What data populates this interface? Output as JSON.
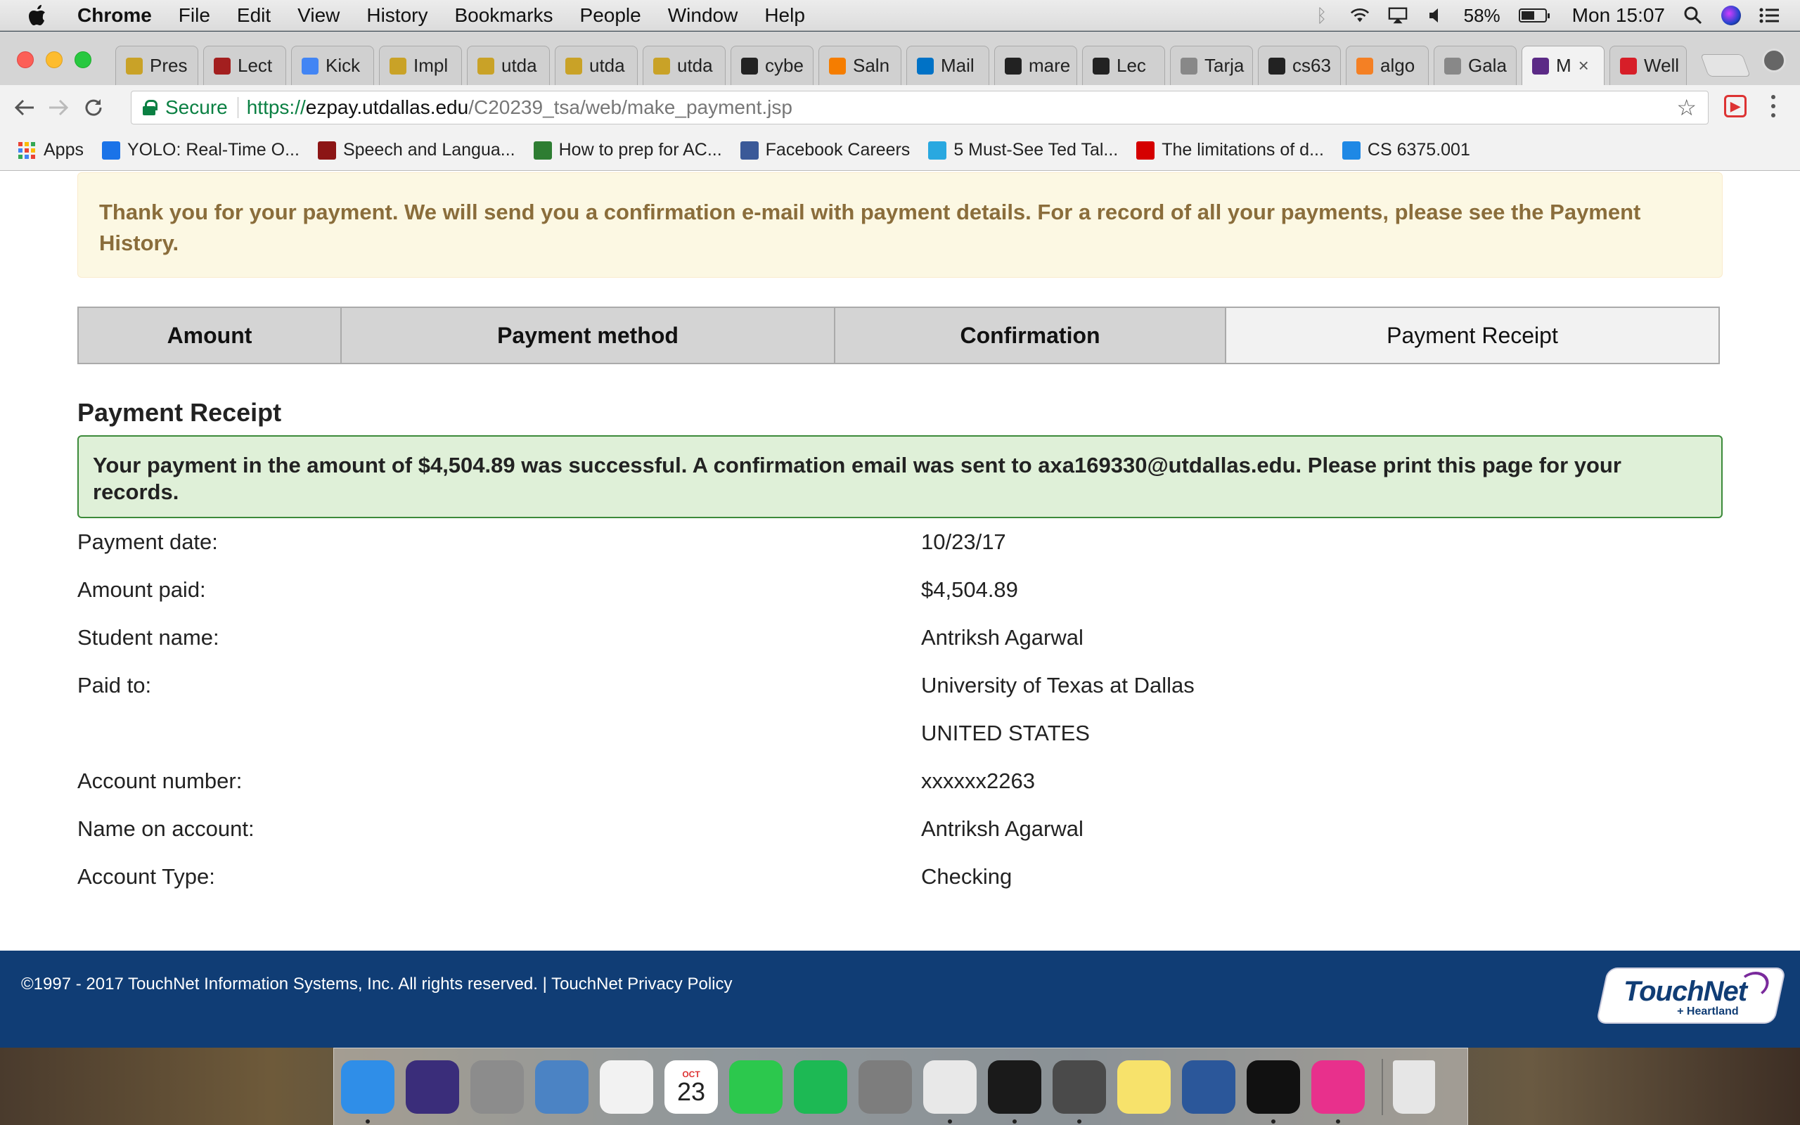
{
  "menubar": {
    "app_name": "Chrome",
    "items": [
      "File",
      "Edit",
      "View",
      "History",
      "Bookmarks",
      "People",
      "Window",
      "Help"
    ],
    "battery": "58%",
    "battery_level": 0.58,
    "clock": "Mon 15:07"
  },
  "tabs": [
    {
      "title": "Pres",
      "icon": "utd-logo",
      "color": "#c9a227"
    },
    {
      "title": "Lect",
      "icon": "c-logo",
      "color": "#a31f1f"
    },
    {
      "title": "Kick",
      "icon": "google-logo",
      "color": "#4285f4"
    },
    {
      "title": "Impl",
      "icon": "utd-logo",
      "color": "#c9a227"
    },
    {
      "title": "utda",
      "icon": "utd-logo",
      "color": "#c9a227"
    },
    {
      "title": "utda",
      "icon": "utd-logo",
      "color": "#c9a227"
    },
    {
      "title": "utda",
      "icon": "utd-logo",
      "color": "#c9a227"
    },
    {
      "title": "cybe",
      "icon": "github-logo",
      "color": "#222222"
    },
    {
      "title": "Saln",
      "icon": "blogger-logo",
      "color": "#f57d00"
    },
    {
      "title": "Mail",
      "icon": "outlook-logo",
      "color": "#0072c6"
    },
    {
      "title": "mare",
      "icon": "github-logo",
      "color": "#222222"
    },
    {
      "title": "Lec",
      "icon": "blackboard-logo",
      "color": "#222222"
    },
    {
      "title": "Tarja",
      "icon": "document-icon",
      "color": "#888888"
    },
    {
      "title": "cs63",
      "icon": "github-logo",
      "color": "#222222"
    },
    {
      "title": "algo",
      "icon": "stackoverflow-logo",
      "color": "#f48024"
    },
    {
      "title": "Gala",
      "icon": "document-icon",
      "color": "#888888"
    },
    {
      "title": "M",
      "icon": "touchnet-logo",
      "color": "#5b2a86",
      "active": true
    },
    {
      "title": "Well",
      "icon": "wellsfargo-logo",
      "color": "#d71e28"
    }
  ],
  "omnibox": {
    "secure_label": "Secure",
    "url_scheme": "https://",
    "url_host": "ezpay.utdallas.edu",
    "url_path": "/C20239_tsa/web/make_payment.jsp"
  },
  "bookmarks": [
    {
      "label": "Apps",
      "icon": "apps-grid-icon"
    },
    {
      "label": "YOLO: Real-Time O...",
      "icon": "yolo-icon",
      "color": "#1a73e8"
    },
    {
      "label": "Speech and Langua...",
      "icon": "stanford-icon",
      "color": "#8c1515"
    },
    {
      "label": "How to prep for AC...",
      "icon": "command-icon",
      "color": "#2e7d32"
    },
    {
      "label": "Facebook Careers",
      "icon": "facebook-icon",
      "color": "#3b5998"
    },
    {
      "label": "5 Must-See Ted Tal...",
      "icon": "cloud-icon",
      "color": "#29a8e0"
    },
    {
      "label": "The limitations of d...",
      "icon": "k-icon",
      "color": "#d50000"
    },
    {
      "label": "CS 6375.001",
      "icon": "p-icon",
      "color": "#1e88e5"
    }
  ],
  "notice": "Thank you for your payment. We will send you a confirmation e-mail with payment details. For a record of all your payments, please see the Payment History.",
  "steps": [
    "Amount",
    "Payment method",
    "Confirmation",
    "Payment Receipt"
  ],
  "receipt": {
    "heading": "Payment Receipt",
    "success_message": "Your payment in the amount of $4,504.89 was successful.  A confirmation email was sent to axa169330@utdallas.edu.  Please print this page for your records.",
    "rows": [
      {
        "label": "Payment date:",
        "value": "10/23/17"
      },
      {
        "label": "Amount paid:",
        "value": "$4,504.89"
      },
      {
        "label": "Student name:",
        "value": "Antriksh Agarwal"
      },
      {
        "label": "Paid to:",
        "value": "University of Texas at Dallas"
      },
      {
        "label": "",
        "value": "UNITED STATES"
      },
      {
        "label": "Account number:",
        "value": "xxxxxx2263"
      },
      {
        "label": "Name on account:",
        "value": "Antriksh Agarwal"
      },
      {
        "label": "Account Type:",
        "value": "Checking"
      }
    ]
  },
  "footer": {
    "copyright": "©1997 - 2017  TouchNet Information Systems, Inc. All rights reserved. | TouchNet Privacy Policy",
    "logo_text": "TouchNet",
    "logo_sub": "+ Heartland"
  },
  "dock": {
    "apps": [
      {
        "name": "Finder",
        "color": "#2f8ee8"
      },
      {
        "name": "Siri",
        "color": "#3a2d7a"
      },
      {
        "name": "Launchpad",
        "color": "#8c8c8c"
      },
      {
        "name": "Mail Stamp",
        "color": "#4b83c4"
      },
      {
        "name": "Photos",
        "color": "#f2f2f2"
      },
      {
        "name": "Calendar",
        "color": "#ffffff",
        "month": "OCT",
        "day": "23"
      },
      {
        "name": "FaceTime",
        "color": "#2cc84d"
      },
      {
        "name": "Spotify",
        "color": "#1db954"
      },
      {
        "name": "System Preferences",
        "color": "#7d7d7d"
      },
      {
        "name": "Chrome",
        "color": "#e8e8e8"
      },
      {
        "name": "Terminal",
        "color": "#1a1a1a"
      },
      {
        "name": "Sublime Text",
        "color": "#4a4a4a"
      },
      {
        "name": "Stickies",
        "color": "#f7e26b"
      },
      {
        "name": "Word",
        "color": "#2b579a"
      },
      {
        "name": "Screen",
        "color": "#111111"
      },
      {
        "name": "IntelliJ",
        "color": "#e8308c"
      }
    ],
    "trash": {
      "name": "Trash",
      "color": "#e6e6e6"
    }
  }
}
